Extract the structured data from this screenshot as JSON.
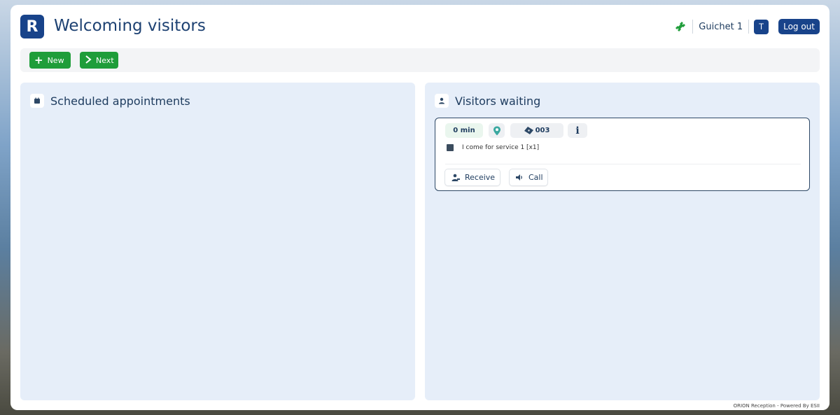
{
  "header": {
    "logo_letter": "R",
    "title": "Welcoming visitors",
    "counter": "Guichet 1",
    "avatar_initial": "T",
    "logout_label": "Log out"
  },
  "toolbar": {
    "new_label": "New",
    "next_label": "Next"
  },
  "scheduled": {
    "title": "Scheduled appointments"
  },
  "waiting": {
    "title": "Visitors waiting",
    "visitors": [
      {
        "wait_time": "0 min",
        "ticket": "003",
        "service": "I come for service 1  [x1]",
        "receive_label": "Receive",
        "call_label": "Call"
      }
    ]
  },
  "footer": {
    "text": "ORION Reception - Powered By ESII"
  },
  "colors": {
    "brand": "#18438a",
    "success": "#1f9d3a",
    "panel_bg": "#e6eef9",
    "text_primary": "#1d3b5e"
  },
  "icons": {
    "plug": "plug-icon",
    "plus": "plus-icon",
    "chevron": "chevron-right-icon",
    "calendar": "calendar-icon",
    "user": "user-icon",
    "location": "location-pin-icon",
    "ticket": "ticket-icon",
    "info": "info-icon",
    "service": "service-icon",
    "receive": "receive-person-icon",
    "speaker": "speaker-icon"
  }
}
